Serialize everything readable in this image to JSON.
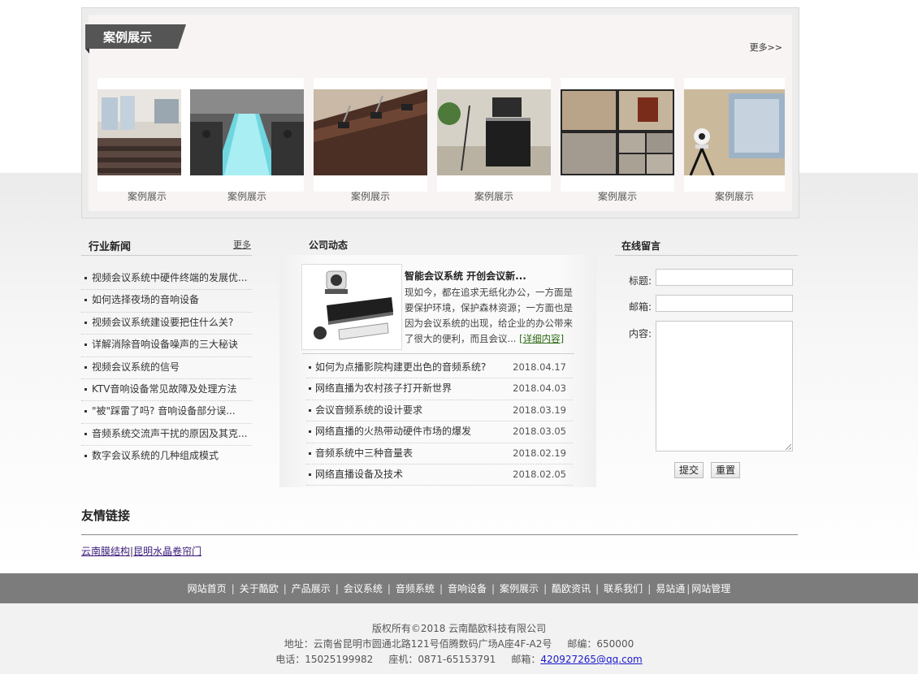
{
  "cases": {
    "title": "案例展示",
    "more": "更多>>",
    "items": [
      {
        "caption": "案例展示"
      },
      {
        "caption": "案例展示"
      },
      {
        "caption": "案例展示"
      },
      {
        "caption": "案例展示"
      },
      {
        "caption": "案例展示"
      },
      {
        "caption": "案例展示"
      }
    ]
  },
  "industry": {
    "title": "行业新闻",
    "more": "更多",
    "items": [
      "视频会议系统中硬件终端的发展优...",
      "如何选择夜场的音响设备",
      "视频会议系统建设要把住什么关?",
      "详解消除音响设备噪声的三大秘诀",
      "视频会议系统的信号",
      "KTV音响设备常见故障及处理方法",
      "\"被\"踩雷了吗? 音响设备部分误...",
      "音频系统交流声干扰的原因及其克...",
      "数字会议系统的几种组成模式"
    ]
  },
  "company": {
    "title": "公司动态",
    "featured": {
      "title": "智能会议系统 开创会议新...",
      "desc": "现如今，都在追求无纸化办公，一方面是要保护环境，保护森林资源；一方面也是因为会议系统的出现，给企业的办公带来了很大的便利，而且会议... ",
      "link": "[详细内容]"
    },
    "items": [
      {
        "title": "如何为点播影院构建更出色的音频系统?",
        "date": "2018.04.17"
      },
      {
        "title": "网络直播为农村孩子打开新世界",
        "date": "2018.04.03"
      },
      {
        "title": "会议音频系统的设计要求",
        "date": "2018.03.19"
      },
      {
        "title": "网络直播的火热带动硬件市场的爆发",
        "date": "2018.03.05"
      },
      {
        "title": "音频系统中三种音量表",
        "date": "2018.02.19"
      },
      {
        "title": "网络直播设备及技术",
        "date": "2018.02.05"
      }
    ]
  },
  "message": {
    "title": "在线留言",
    "subject_label": "标题:",
    "email_label": "邮箱:",
    "content_label": "内容:",
    "submit": "提交",
    "reset": "重置"
  },
  "friends": {
    "title": "友情链接",
    "links": [
      "云南膜结构",
      "昆明水晶卷帘门"
    ]
  },
  "footer_nav": [
    "网站首页",
    "关于酷欧",
    "产品展示",
    "会议系统",
    "音频系统",
    "音响设备",
    "案例展示",
    "酷欧资讯",
    "联系我们",
    "易站通",
    "网站管理"
  ],
  "footer": {
    "copyright": "版权所有©2018 云南酷欧科技有限公司",
    "address": "地址：云南省昆明市圆通北路121号佰腾数码广场A座4F-A2号     邮编：650000",
    "phone_prefix": "电话：15025199982     座机：0871-65153791     邮箱：",
    "email": "420927265@qq.com"
  },
  "colors": {
    "tab_bg": "#555555",
    "footer_nav_bg": "#7c7c7c",
    "link_green": "#2c6a14"
  }
}
